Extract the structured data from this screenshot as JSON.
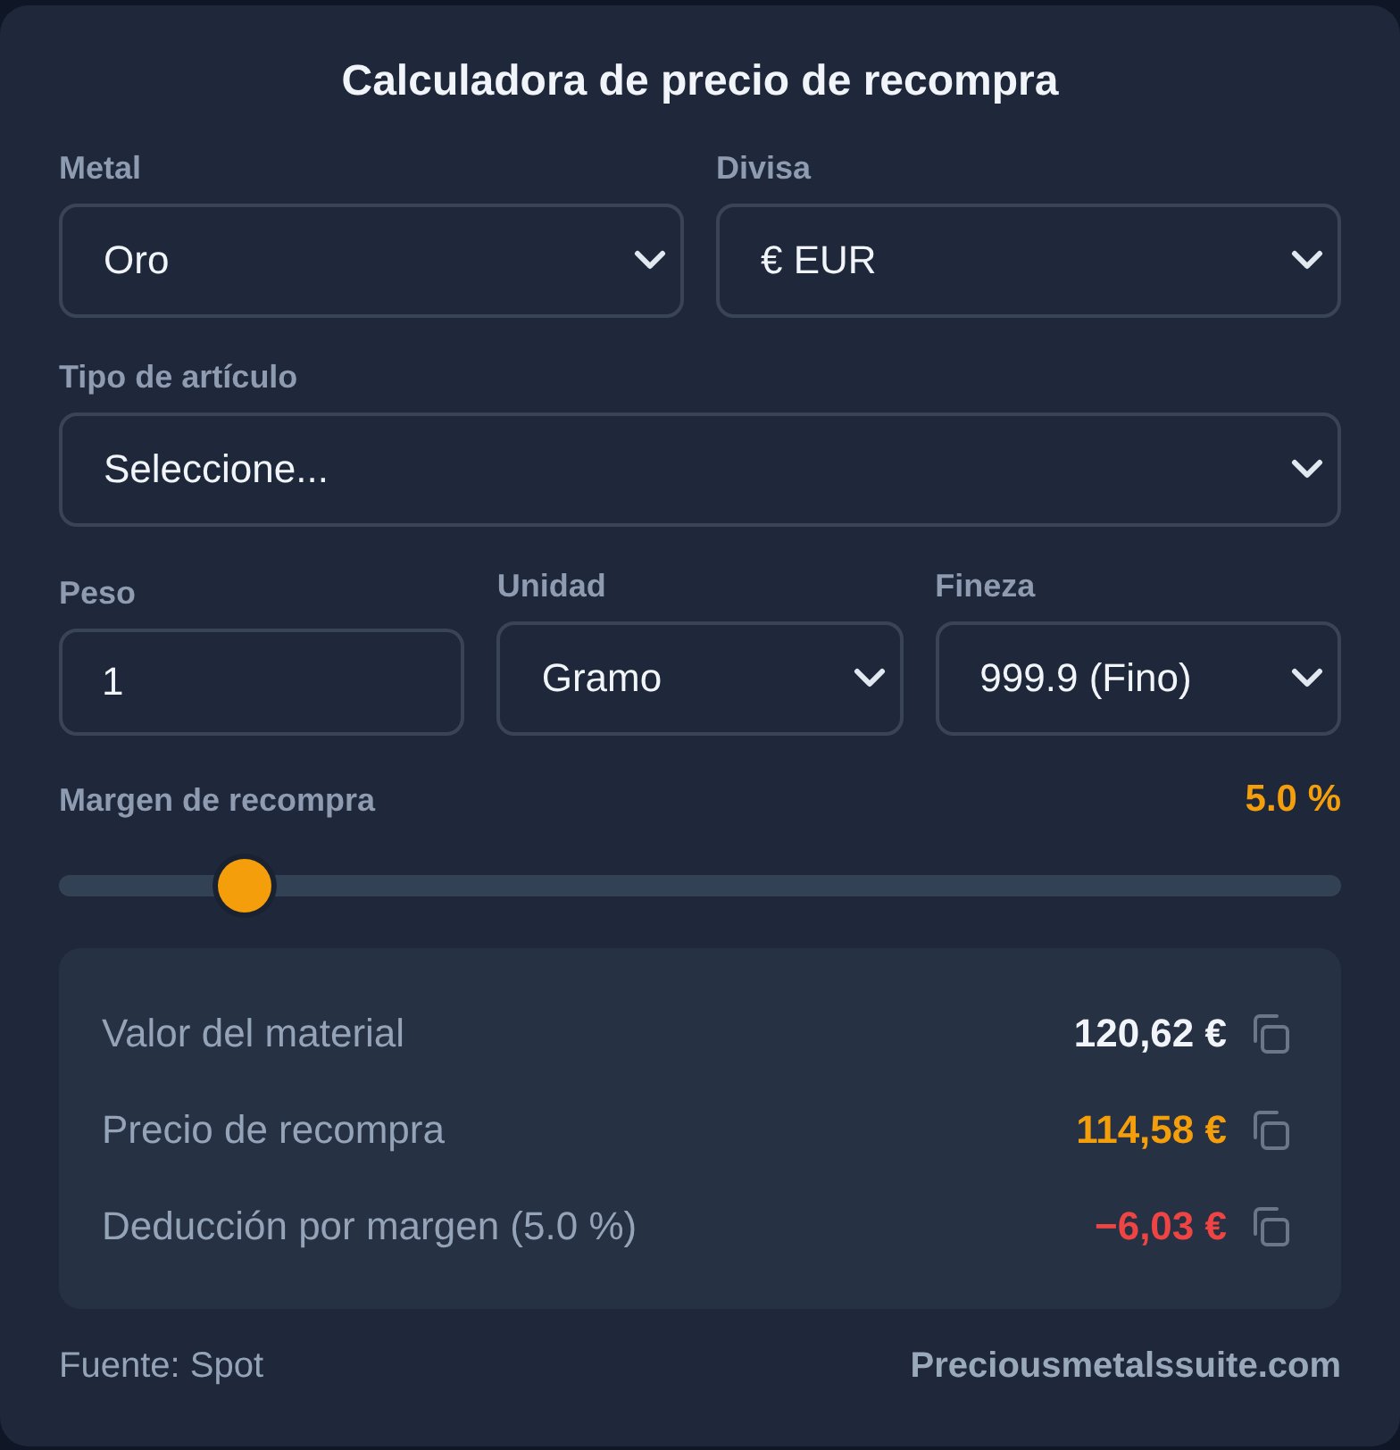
{
  "title": "Calculadora de precio de recompra",
  "form_rows": [
    [
      {
        "kind": "select",
        "label": "Metal",
        "value": "Oro"
      },
      {
        "kind": "select",
        "label": "Divisa",
        "value": "€ EUR"
      }
    ],
    [
      {
        "kind": "select",
        "label": "Tipo de artículo",
        "value": "Seleccione..."
      }
    ],
    [
      {
        "kind": "input",
        "label": "Peso",
        "value": "1"
      },
      {
        "kind": "select",
        "label": "Unidad",
        "value": "Gramo"
      },
      {
        "kind": "select",
        "label": "Fineza",
        "value": "999.9 (Fino)"
      }
    ]
  ],
  "margin": {
    "label": "Margen de recompra",
    "reading": "5.0 %",
    "level": 0.13
  },
  "results": [
    {
      "label": "Valor del material",
      "value": "120,62 €",
      "color": "#f1f5f9"
    },
    {
      "label": "Precio de recompra",
      "value": "114,58 €",
      "color": "#f59e0b"
    },
    {
      "label": "Deducción por margen (5.0 %)",
      "value": "−6,03 €",
      "color": "#ef4444"
    }
  ],
  "footer": {
    "source": "Fuente: Spot",
    "link": "Preciousmetalssuite.com"
  }
}
